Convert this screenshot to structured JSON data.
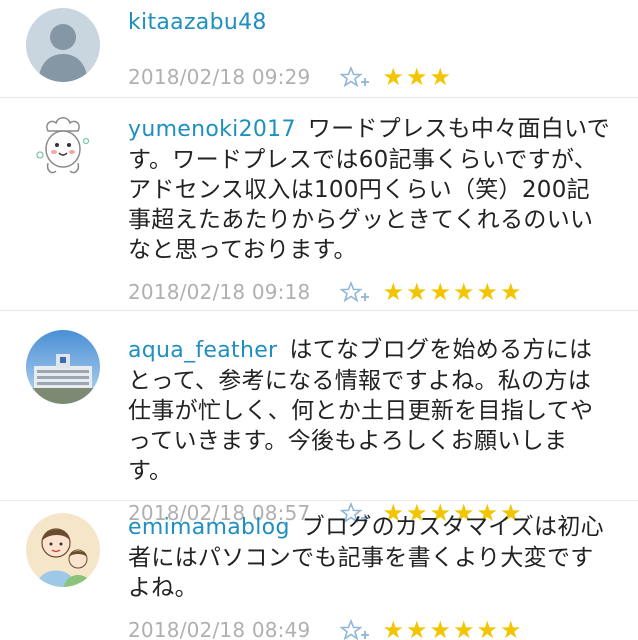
{
  "comments": [
    {
      "user": "kitaazabu48",
      "text": "",
      "timestamp": "2018/02/18 09:29",
      "stars": "★★★",
      "avatar": "default-person-icon"
    },
    {
      "user": "yumenoki2017",
      "text": "ワードプレスも中々面白いです。ワードプレスでは60記事くらいですが、アドセンス収入は100円くらい（笑）200記事超えたあたりからグッときてくれるのいいなと思っております。",
      "timestamp": "2018/02/18 09:18",
      "stars": "★★★★★★",
      "avatar": "chef-character-icon"
    },
    {
      "user": "aqua_feather",
      "text": "はてなブログを始める方にはとって、参考になる情報ですよね。私の方は仕事が忙しく、何とか土日更新を目指してやっていきます。今後もよろしくお願いします。",
      "timestamp": "2018/02/18 08:57",
      "stars": "★★★★★★",
      "avatar": "building-photo-icon"
    },
    {
      "user": "emimamablog",
      "text": "ブログのカスタマイズは初心者にはパソコンでも記事を書くより大変ですよね。",
      "timestamp": "2018/02/18 08:49",
      "stars": "★★★★★★",
      "avatar": "family-illustration-icon"
    }
  ],
  "colors": {
    "username": "#1e8fbf",
    "timestamp": "#b0b0b0",
    "star": "#f2c500",
    "add_star": "#8fb6d8"
  }
}
